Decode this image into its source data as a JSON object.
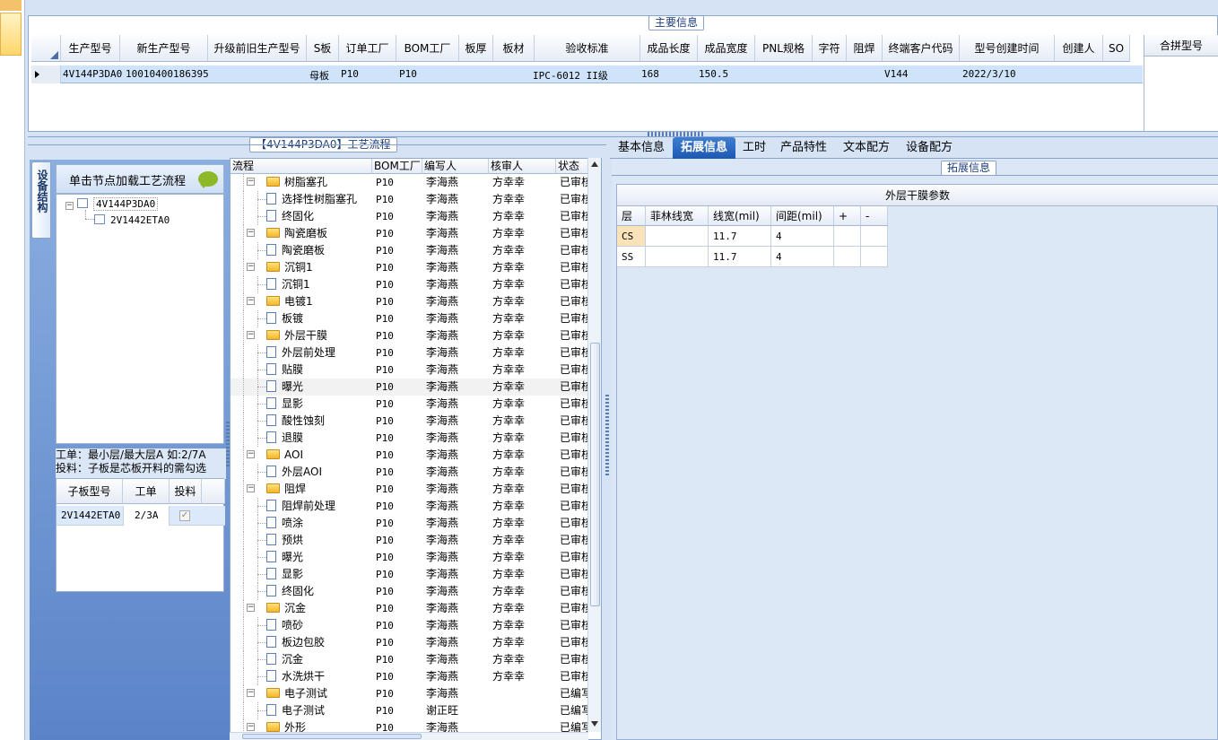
{
  "main_info": {
    "title": "主要信息",
    "columns": [
      "生产型号",
      "新生产型号",
      "升级前旧生产型号",
      "S板",
      "订单工厂",
      "BOM工厂",
      "板厚",
      "板材",
      "验收标准",
      "成品长度",
      "成品宽度",
      "PNL规格",
      "字符",
      "阻焊",
      "终端客户代码",
      "型号创建时间",
      "创建人",
      "SO"
    ],
    "row": [
      "4V144P3DA0",
      "10010400186395",
      "",
      "母板",
      "P10",
      "P10",
      "",
      "",
      "IPC-6012 II级",
      "168",
      "150.5",
      "",
      "",
      "",
      "V144",
      "2022/3/10",
      "",
      ""
    ],
    "merge_header": "合拼型号"
  },
  "flow_section": {
    "title": "【4V144P3DA0】工艺流程"
  },
  "left_tab": {
    "label": "设备结构"
  },
  "load_flow": {
    "label": "单击节点加载工艺流程"
  },
  "model_tree": [
    {
      "label": "4V144P3DA0"
    },
    {
      "label": "2V1442ETA0"
    }
  ],
  "tip": {
    "line1": "工单：最小层/最大层A 如:2/7A",
    "line2": "投料：子板是芯板开料的需勾选"
  },
  "sub_grid": {
    "columns": [
      "子板型号",
      "工单",
      "投料"
    ],
    "rows": [
      {
        "model": "2V1442ETA0",
        "order": "2/3A",
        "feed": true
      }
    ]
  },
  "flow_grid": {
    "columns": [
      "流程",
      "BOM工厂",
      "编写人",
      "核审人",
      "状态"
    ],
    "rows": [
      {
        "name": "树脂塞孔",
        "level": 0,
        "bom": "P10",
        "writer": "李海燕",
        "reviewer": "方幸幸",
        "status": "已审核"
      },
      {
        "name": "选择性树脂塞孔",
        "level": 1,
        "bom": "P10",
        "writer": "李海燕",
        "reviewer": "方幸幸",
        "status": "已审核"
      },
      {
        "name": "终固化",
        "level": 1,
        "bom": "P10",
        "writer": "李海燕",
        "reviewer": "方幸幸",
        "status": "已审核"
      },
      {
        "name": "陶瓷磨板",
        "level": 0,
        "bom": "P10",
        "writer": "李海燕",
        "reviewer": "方幸幸",
        "status": "已审核"
      },
      {
        "name": "陶瓷磨板",
        "level": 1,
        "bom": "P10",
        "writer": "李海燕",
        "reviewer": "方幸幸",
        "status": "已审核"
      },
      {
        "name": "沉铜1",
        "level": 0,
        "bom": "P10",
        "writer": "李海燕",
        "reviewer": "方幸幸",
        "status": "已审核"
      },
      {
        "name": "沉铜1",
        "level": 1,
        "bom": "P10",
        "writer": "李海燕",
        "reviewer": "方幸幸",
        "status": "已审核"
      },
      {
        "name": "电镀1",
        "level": 0,
        "bom": "P10",
        "writer": "李海燕",
        "reviewer": "方幸幸",
        "status": "已审核"
      },
      {
        "name": "板镀",
        "level": 1,
        "bom": "P10",
        "writer": "李海燕",
        "reviewer": "方幸幸",
        "status": "已审核"
      },
      {
        "name": "外层干膜",
        "level": 0,
        "bom": "P10",
        "writer": "李海燕",
        "reviewer": "方幸幸",
        "status": "已审核"
      },
      {
        "name": "外层前处理",
        "level": 1,
        "bom": "P10",
        "writer": "李海燕",
        "reviewer": "方幸幸",
        "status": "已审核"
      },
      {
        "name": "贴膜",
        "level": 1,
        "bom": "P10",
        "writer": "李海燕",
        "reviewer": "方幸幸",
        "status": "已审核"
      },
      {
        "name": "曝光",
        "level": 1,
        "bom": "P10",
        "writer": "李海燕",
        "reviewer": "方幸幸",
        "status": "已审核",
        "selected": true
      },
      {
        "name": "显影",
        "level": 1,
        "bom": "P10",
        "writer": "李海燕",
        "reviewer": "方幸幸",
        "status": "已审核"
      },
      {
        "name": "酸性蚀刻",
        "level": 1,
        "bom": "P10",
        "writer": "李海燕",
        "reviewer": "方幸幸",
        "status": "已审核"
      },
      {
        "name": "退膜",
        "level": 1,
        "bom": "P10",
        "writer": "李海燕",
        "reviewer": "方幸幸",
        "status": "已审核"
      },
      {
        "name": "AOI",
        "level": 0,
        "bom": "P10",
        "writer": "李海燕",
        "reviewer": "方幸幸",
        "status": "已审核"
      },
      {
        "name": "外层AOI",
        "level": 1,
        "bom": "P10",
        "writer": "李海燕",
        "reviewer": "方幸幸",
        "status": "已审核"
      },
      {
        "name": "阻焊",
        "level": 0,
        "bom": "P10",
        "writer": "李海燕",
        "reviewer": "方幸幸",
        "status": "已审核"
      },
      {
        "name": "阻焊前处理",
        "level": 1,
        "bom": "P10",
        "writer": "李海燕",
        "reviewer": "方幸幸",
        "status": "已审核"
      },
      {
        "name": "喷涂",
        "level": 1,
        "bom": "P10",
        "writer": "李海燕",
        "reviewer": "方幸幸",
        "status": "已审核"
      },
      {
        "name": "预烘",
        "level": 1,
        "bom": "P10",
        "writer": "李海燕",
        "reviewer": "方幸幸",
        "status": "已审核"
      },
      {
        "name": "曝光",
        "level": 1,
        "bom": "P10",
        "writer": "李海燕",
        "reviewer": "方幸幸",
        "status": "已审核"
      },
      {
        "name": "显影",
        "level": 1,
        "bom": "P10",
        "writer": "李海燕",
        "reviewer": "方幸幸",
        "status": "已审核"
      },
      {
        "name": "终固化",
        "level": 1,
        "bom": "P10",
        "writer": "李海燕",
        "reviewer": "方幸幸",
        "status": "已审核"
      },
      {
        "name": "沉金",
        "level": 0,
        "bom": "P10",
        "writer": "李海燕",
        "reviewer": "方幸幸",
        "status": "已审核"
      },
      {
        "name": "喷砂",
        "level": 1,
        "bom": "P10",
        "writer": "李海燕",
        "reviewer": "方幸幸",
        "status": "已审核"
      },
      {
        "name": "板边包胶",
        "level": 1,
        "bom": "P10",
        "writer": "李海燕",
        "reviewer": "方幸幸",
        "status": "已审核"
      },
      {
        "name": "沉金",
        "level": 1,
        "bom": "P10",
        "writer": "李海燕",
        "reviewer": "方幸幸",
        "status": "已审核"
      },
      {
        "name": "水洗烘干",
        "level": 1,
        "bom": "P10",
        "writer": "李海燕",
        "reviewer": "方幸幸",
        "status": "已审核"
      },
      {
        "name": "电子测试",
        "level": 0,
        "bom": "P10",
        "writer": "李海燕",
        "reviewer": "",
        "status": "已编写"
      },
      {
        "name": "电子测试",
        "level": 1,
        "bom": "P10",
        "writer": "谢正旺",
        "reviewer": "",
        "status": "已编写"
      },
      {
        "name": "外形",
        "level": 0,
        "bom": "P10",
        "writer": "李海燕",
        "reviewer": "",
        "status": "已编写"
      }
    ]
  },
  "right_tabs": [
    "基本信息",
    "拓展信息",
    "工时",
    "产品特性",
    "文本配方",
    "设备配方"
  ],
  "active_tab": 1,
  "ext_info": {
    "title": "拓展信息"
  },
  "param_grid": {
    "title": "外层干膜参数",
    "columns": [
      "层",
      "菲林线宽",
      "线宽(mil)",
      "间距(mil)",
      "+",
      "-"
    ],
    "rows": [
      {
        "layer": "CS",
        "film": "",
        "width": "11.7",
        "spacing": "4"
      },
      {
        "layer": "SS",
        "film": "",
        "width": "11.7",
        "spacing": "4"
      }
    ]
  },
  "colors": {
    "accent": "#1d58b0",
    "selection": "#cfe3fa",
    "folder": "#f3b62c"
  }
}
